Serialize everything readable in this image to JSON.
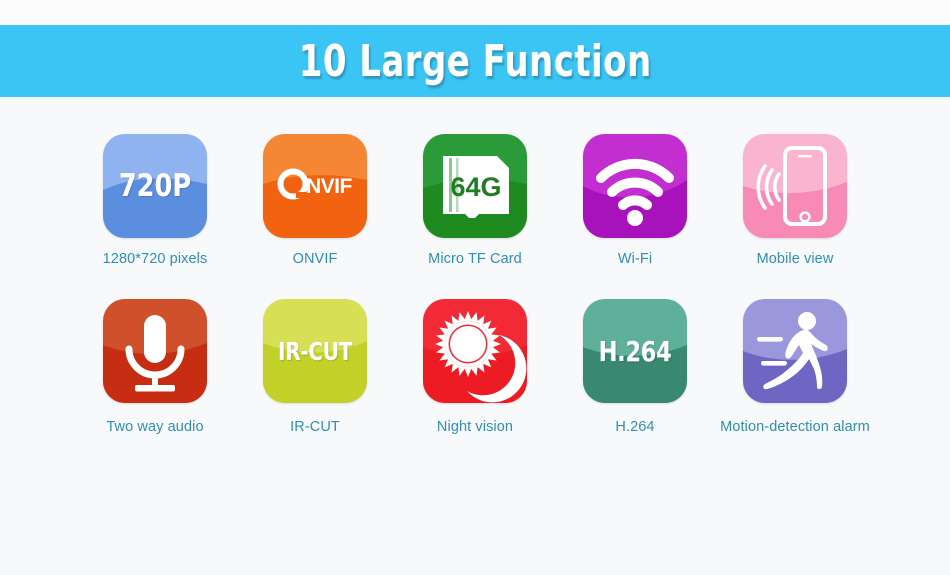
{
  "header": {
    "title": "10 Large Function",
    "background_color": "#3bc5f5",
    "text_color": "#ffffff"
  },
  "page": {
    "background_color": "#f8f9fa",
    "label_color": "#2e8fb8"
  },
  "features": [
    {
      "id": "resolution",
      "label": "1280*720 pixels",
      "icon": "720p-text-icon",
      "tile_text": "720P",
      "color_top": "#8fb3ef",
      "color_bottom": "#5c8ee0"
    },
    {
      "id": "onvif",
      "label": "ONVIF",
      "icon": "onvif-logo-icon",
      "tile_text": "Onvif",
      "color_top": "#f58634",
      "color_bottom": "#f26311"
    },
    {
      "id": "micro-tf-card",
      "label": "Micro TF Card",
      "icon": "sd-card-icon",
      "tile_text": "64G",
      "color_top": "#2b9b3a",
      "color_bottom": "#1f8a1f"
    },
    {
      "id": "wifi",
      "label": "Wi-Fi",
      "icon": "wifi-icon",
      "tile_text": "",
      "color_top": "#c22ed0",
      "color_bottom": "#a712bd"
    },
    {
      "id": "mobile-view",
      "label": "Mobile view",
      "icon": "mobile-phone-icon",
      "tile_text": "",
      "color_top": "#fbb4ce",
      "color_bottom": "#f78bb5"
    },
    {
      "id": "two-way-audio",
      "label": "Two way audio",
      "icon": "microphone-icon",
      "tile_text": "",
      "color_top": "#d0502c",
      "color_bottom": "#c62d12"
    },
    {
      "id": "ir-cut",
      "label": "IR-CUT",
      "icon": "ir-cut-text-icon",
      "tile_text": "IR-CUT",
      "color_top": "#d7df54",
      "color_bottom": "#c2d027"
    },
    {
      "id": "night-vision",
      "label": "Night vision",
      "icon": "sun-moon-icon",
      "tile_text": "",
      "color_top": "#f22a36",
      "color_bottom": "#ed1b24"
    },
    {
      "id": "h264",
      "label": "H.264",
      "icon": "h264-text-icon",
      "tile_text": "H.264",
      "color_top": "#5fb09b",
      "color_bottom": "#38896f"
    },
    {
      "id": "motion-detection-alarm",
      "label": "Motion-detection alarm",
      "icon": "running-person-icon",
      "tile_text": "",
      "color_top": "#9a97dd",
      "color_bottom": "#6f66c4"
    }
  ]
}
